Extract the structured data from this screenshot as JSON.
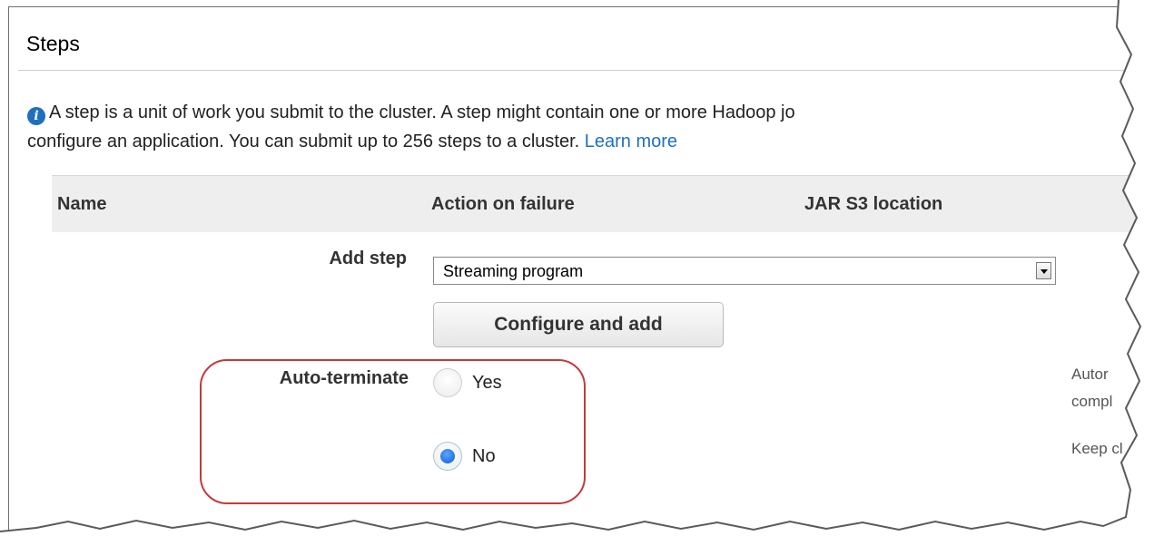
{
  "section": {
    "title": "Steps"
  },
  "info": {
    "line1": "A step is a unit of work you submit to the cluster. A step might contain one or more Hadoop jo",
    "line2": "configure an application. You can submit up to 256 steps to a cluster.",
    "link": "Learn more",
    "icon": "info-icon"
  },
  "table": {
    "columns": [
      "Name",
      "Action on failure",
      "JAR S3 location"
    ]
  },
  "add_step": {
    "label": "Add step",
    "selected": "Streaming program",
    "button": "Configure and add"
  },
  "auto_terminate": {
    "label": "Auto-terminate",
    "options": [
      {
        "label": "Yes",
        "checked": false
      },
      {
        "label": "No",
        "checked": true
      }
    ],
    "side_text": [
      "Autor",
      "compl",
      "Keep cl"
    ]
  },
  "colors": {
    "link": "#1e70bf",
    "highlight": "#c23a3a",
    "radio_selected": "#0a5fd6"
  }
}
